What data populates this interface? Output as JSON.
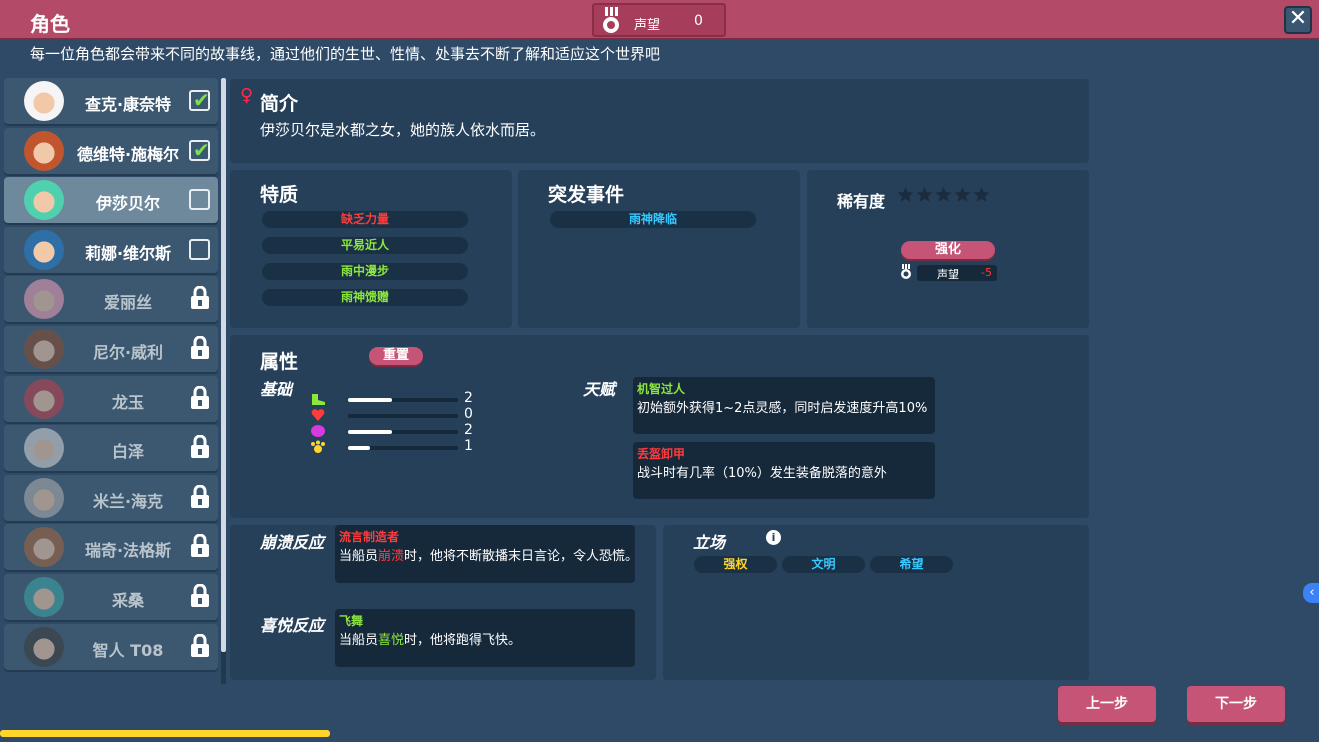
{
  "header": {
    "title": "角色",
    "prestige_label": "声望",
    "prestige_value": "0",
    "close_label": "✕"
  },
  "subtitle": "每一位角色都会带来不同的故事线，通过他们的生世、性情、处事去不断了解和适应这个世界吧",
  "characters": [
    {
      "name": "查克·康奈特",
      "state": "checked"
    },
    {
      "name": "德维特·施梅尔",
      "state": "checked"
    },
    {
      "name": "伊莎贝尔",
      "state": "unchecked",
      "selected": true
    },
    {
      "name": "莉娜·维尔斯",
      "state": "unchecked"
    },
    {
      "name": "爱丽丝",
      "state": "locked"
    },
    {
      "name": "尼尔·威利",
      "state": "locked"
    },
    {
      "name": "龙玉",
      "state": "locked"
    },
    {
      "name": "白泽",
      "state": "locked"
    },
    {
      "name": "米兰·海克",
      "state": "locked"
    },
    {
      "name": "瑞奇·法格斯",
      "state": "locked"
    },
    {
      "name": "采桑",
      "state": "locked"
    },
    {
      "name": "智人 T08",
      "state": "locked"
    }
  ],
  "intro": {
    "gender_symbol": "♀",
    "heading": "简介",
    "text": "伊莎贝尔是水都之女，她的族人依水而居。"
  },
  "traits": {
    "heading": "特质",
    "items": [
      {
        "label": "缺乏力量",
        "color": "#ff3b3b"
      },
      {
        "label": "平易近人",
        "color": "#8be63d"
      },
      {
        "label": "雨中漫步",
        "color": "#8be63d"
      },
      {
        "label": "雨神馈赠",
        "color": "#8be63d"
      }
    ]
  },
  "events": {
    "heading": "突发事件",
    "items": [
      {
        "label": "雨神降临",
        "color": "#38c8ff"
      }
    ]
  },
  "rarity": {
    "heading": "稀有度",
    "stars_filled": 0,
    "stars_total": 5,
    "upgrade_label": "强化",
    "cost_label": "声望",
    "cost_value": "-5"
  },
  "attributes": {
    "heading": "属性",
    "reset_label": "重置",
    "base_label": "基础",
    "stats": [
      {
        "icon": "boot-icon",
        "color": "#8be63d",
        "value": 2,
        "max": 5
      },
      {
        "icon": "heart-icon",
        "color": "#ff3b3b",
        "value": 0,
        "max": 5
      },
      {
        "icon": "brain-icon",
        "color": "#d63be0",
        "value": 2,
        "max": 5
      },
      {
        "icon": "paw-icon",
        "color": "#ffd52a",
        "value": 1,
        "max": 5
      }
    ],
    "talent_label": "天赋",
    "talents": [
      {
        "name": "机智过人",
        "color": "#8be63d",
        "desc": "初始额外获得1~2点灵感，同时启发速度升高10%"
      },
      {
        "name": "丢盔卸甲",
        "color": "#ff3b3b",
        "desc": "战斗时有几率（10%）发生装备脱落的意外"
      }
    ]
  },
  "reactions": {
    "collapse_label": "崩溃反应",
    "collapse_name": "流言制造者",
    "collapse_desc_pre": "当船员",
    "collapse_desc_key": "崩溃",
    "collapse_desc_post": "时，他将不断散播末日言论，令人恐慌。",
    "joy_label": "喜悦反应",
    "joy_name": "飞舞",
    "joy_desc_pre": "当船员",
    "joy_desc_key": "喜悦",
    "joy_desc_post": "时，他将跑得飞快。"
  },
  "stance": {
    "heading": "立场",
    "info_label": "i",
    "items": [
      {
        "label": "强权",
        "color": "#ffd52a"
      },
      {
        "label": "文明",
        "color": "#38c8ff"
      },
      {
        "label": "希望",
        "color": "#38c8ff"
      }
    ]
  },
  "nav": {
    "prev_label": "上一步",
    "next_label": "下一步"
  },
  "progress": 0.25
}
